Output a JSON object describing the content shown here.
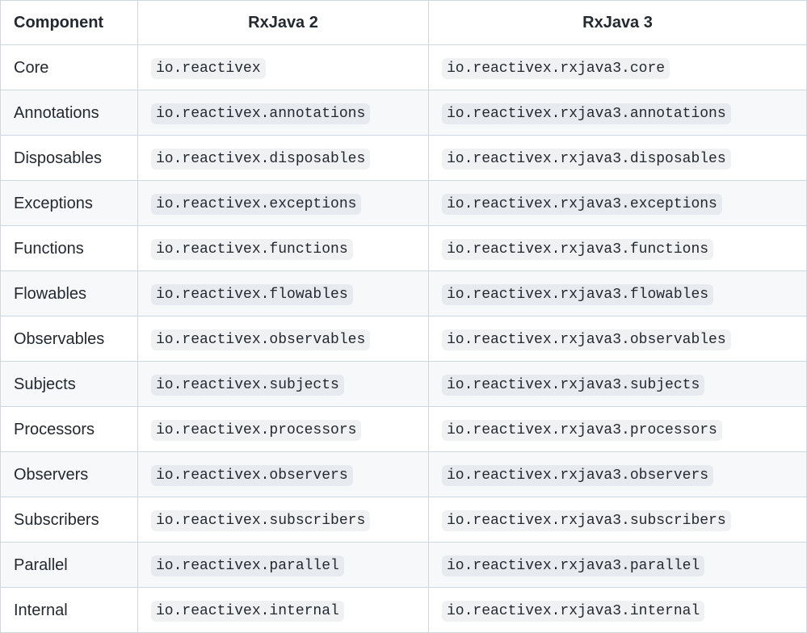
{
  "table": {
    "headers": {
      "component": "Component",
      "v2": "RxJava 2",
      "v3": "RxJava 3"
    },
    "rows": [
      {
        "component": "Core",
        "v2": "io.reactivex",
        "v3": "io.reactivex.rxjava3.core"
      },
      {
        "component": "Annotations",
        "v2": "io.reactivex.annotations",
        "v3": "io.reactivex.rxjava3.annotations"
      },
      {
        "component": "Disposables",
        "v2": "io.reactivex.disposables",
        "v3": "io.reactivex.rxjava3.disposables"
      },
      {
        "component": "Exceptions",
        "v2": "io.reactivex.exceptions",
        "v3": "io.reactivex.rxjava3.exceptions"
      },
      {
        "component": "Functions",
        "v2": "io.reactivex.functions",
        "v3": "io.reactivex.rxjava3.functions"
      },
      {
        "component": "Flowables",
        "v2": "io.reactivex.flowables",
        "v3": "io.reactivex.rxjava3.flowables"
      },
      {
        "component": "Observables",
        "v2": "io.reactivex.observables",
        "v3": "io.reactivex.rxjava3.observables"
      },
      {
        "component": "Subjects",
        "v2": "io.reactivex.subjects",
        "v3": "io.reactivex.rxjava3.subjects"
      },
      {
        "component": "Processors",
        "v2": "io.reactivex.processors",
        "v3": "io.reactivex.rxjava3.processors"
      },
      {
        "component": "Observers",
        "v2": "io.reactivex.observers",
        "v3": "io.reactivex.rxjava3.observers"
      },
      {
        "component": "Subscribers",
        "v2": "io.reactivex.subscribers",
        "v3": "io.reactivex.rxjava3.subscribers"
      },
      {
        "component": "Parallel",
        "v2": "io.reactivex.parallel",
        "v3": "io.reactivex.rxjava3.parallel"
      },
      {
        "component": "Internal",
        "v2": "io.reactivex.internal",
        "v3": "io.reactivex.rxjava3.internal"
      }
    ]
  }
}
